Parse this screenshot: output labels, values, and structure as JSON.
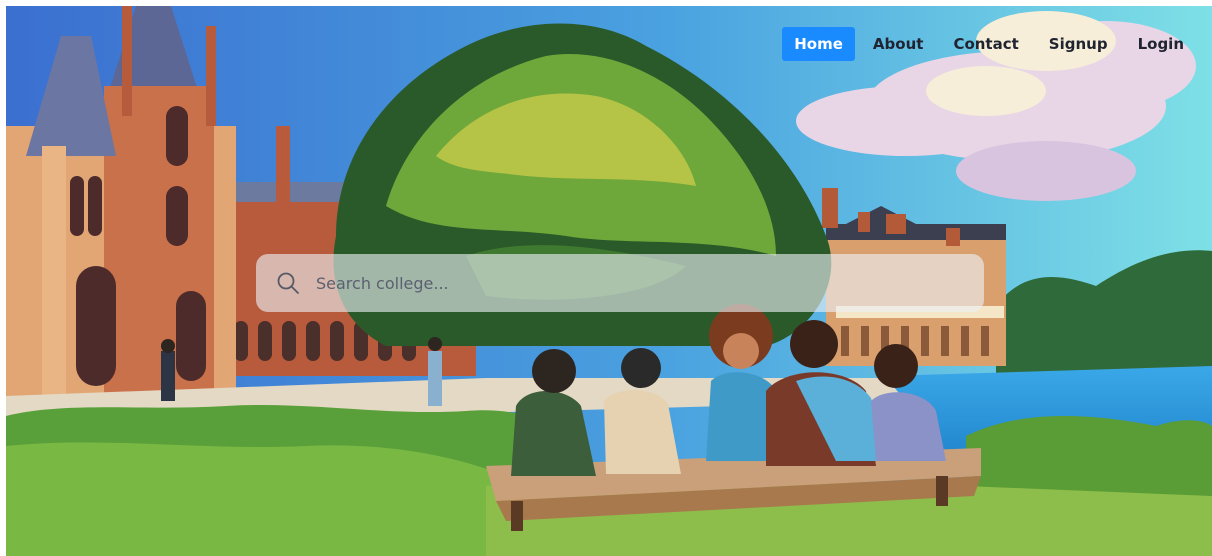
{
  "nav": {
    "items": [
      {
        "label": "Home",
        "active": true
      },
      {
        "label": "About",
        "active": false
      },
      {
        "label": "Contact",
        "active": false
      },
      {
        "label": "Signup",
        "active": false
      },
      {
        "label": "Login",
        "active": false
      }
    ]
  },
  "search": {
    "placeholder": "Search college...",
    "icon": "search-icon"
  },
  "colors": {
    "accent": "#1a8bff"
  }
}
